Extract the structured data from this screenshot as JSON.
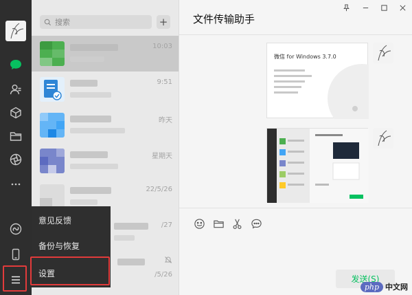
{
  "search": {
    "placeholder": "搜索",
    "icon": "search-icon"
  },
  "plus_label": "+",
  "sidebar": {
    "icons": [
      "chat-icon",
      "contacts-icon",
      "favorites-icon",
      "files-icon",
      "moments-icon",
      "more-icon",
      "miniprogram-icon",
      "phone-icon",
      "menu-icon"
    ]
  },
  "chats": [
    {
      "time": "10:03"
    },
    {
      "time": "9:51"
    },
    {
      "time": "昨天"
    },
    {
      "time": "星期天"
    },
    {
      "time": "22/5/26"
    },
    {
      "time": "/27"
    },
    {
      "time": ""
    },
    {
      "time": "/5/26"
    }
  ],
  "menu": {
    "feedback": "意见反馈",
    "backup": "备份与恢复",
    "settings": "设置"
  },
  "pane": {
    "title": "文件传输助手",
    "send_label": "发送(S)",
    "card_title": "微信 for Windows 3.7.0"
  },
  "colors": {
    "accent": "#07c160",
    "highlight": "#e23b3b",
    "sidebar": "#2e2e2e"
  },
  "watermark": {
    "php": "php",
    "text": "中文网"
  }
}
